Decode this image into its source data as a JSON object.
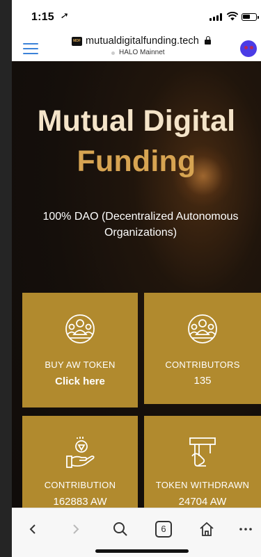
{
  "status_bar": {
    "time": "1:15"
  },
  "browser": {
    "domain": "mutualdigitalfunding.tech",
    "network": "HALO Mainnet",
    "favicon_text": "MDF",
    "tab_count": "6",
    "accent_color": "#3b82d8"
  },
  "hero": {
    "title_line1": "Mutual Digital",
    "title_line2": "Funding",
    "subtitle": "100% DAO (Decentralized Autonomous Organizations)",
    "title_color": "#f4e4c9",
    "accent_color": "#d7a452"
  },
  "cards": [
    {
      "icon": "group-icon",
      "label": "BUY AW TOKEN",
      "value": "Click here"
    },
    {
      "icon": "group-icon",
      "label": "CONTRIBUTORS",
      "value": "135"
    },
    {
      "icon": "coin-hand-icon",
      "label": "CONTRIBUTION",
      "value": "162883 AW"
    },
    {
      "icon": "atm-withdraw-icon",
      "label": "TOKEN WITHDRAWN",
      "value": "24704 AW"
    }
  ],
  "card_color": "#b18a2e",
  "toolbar": {
    "items": [
      "back-icon",
      "forward-icon",
      "search-icon",
      "tabs-icon",
      "home-icon",
      "more-icon"
    ]
  }
}
